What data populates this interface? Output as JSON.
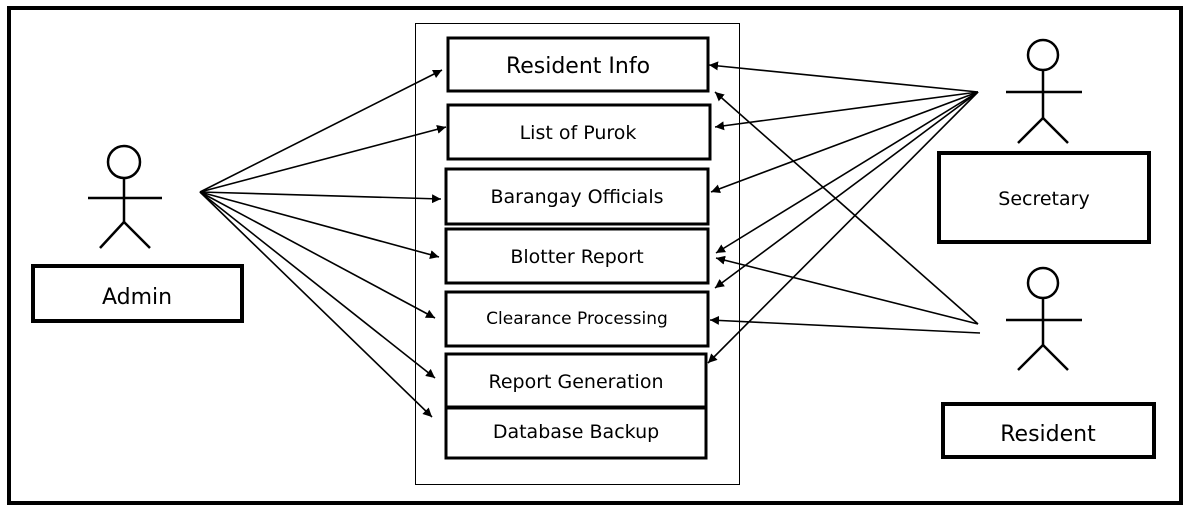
{
  "actors": {
    "admin": "Admin",
    "secretary": "Secretary",
    "resident": "Resident"
  },
  "use_cases": [
    "Resident Info",
    "List of Purok",
    "Barangay Officials",
    "Blotter Report",
    "Clearance Processing",
    "Report Generation",
    "Database Backup"
  ],
  "associations": {
    "admin": [
      "Resident Info",
      "List of Purok",
      "Barangay Officials",
      "Blotter Report",
      "Clearance Processing",
      "Report Generation",
      "Database Backup"
    ],
    "secretary": [
      "Resident Info",
      "List of Purok",
      "Barangay Officials",
      "Blotter Report",
      "Clearance Processing",
      "Report Generation"
    ],
    "resident": [
      "Resident Info",
      "Blotter Report",
      "Clearance Processing"
    ]
  }
}
